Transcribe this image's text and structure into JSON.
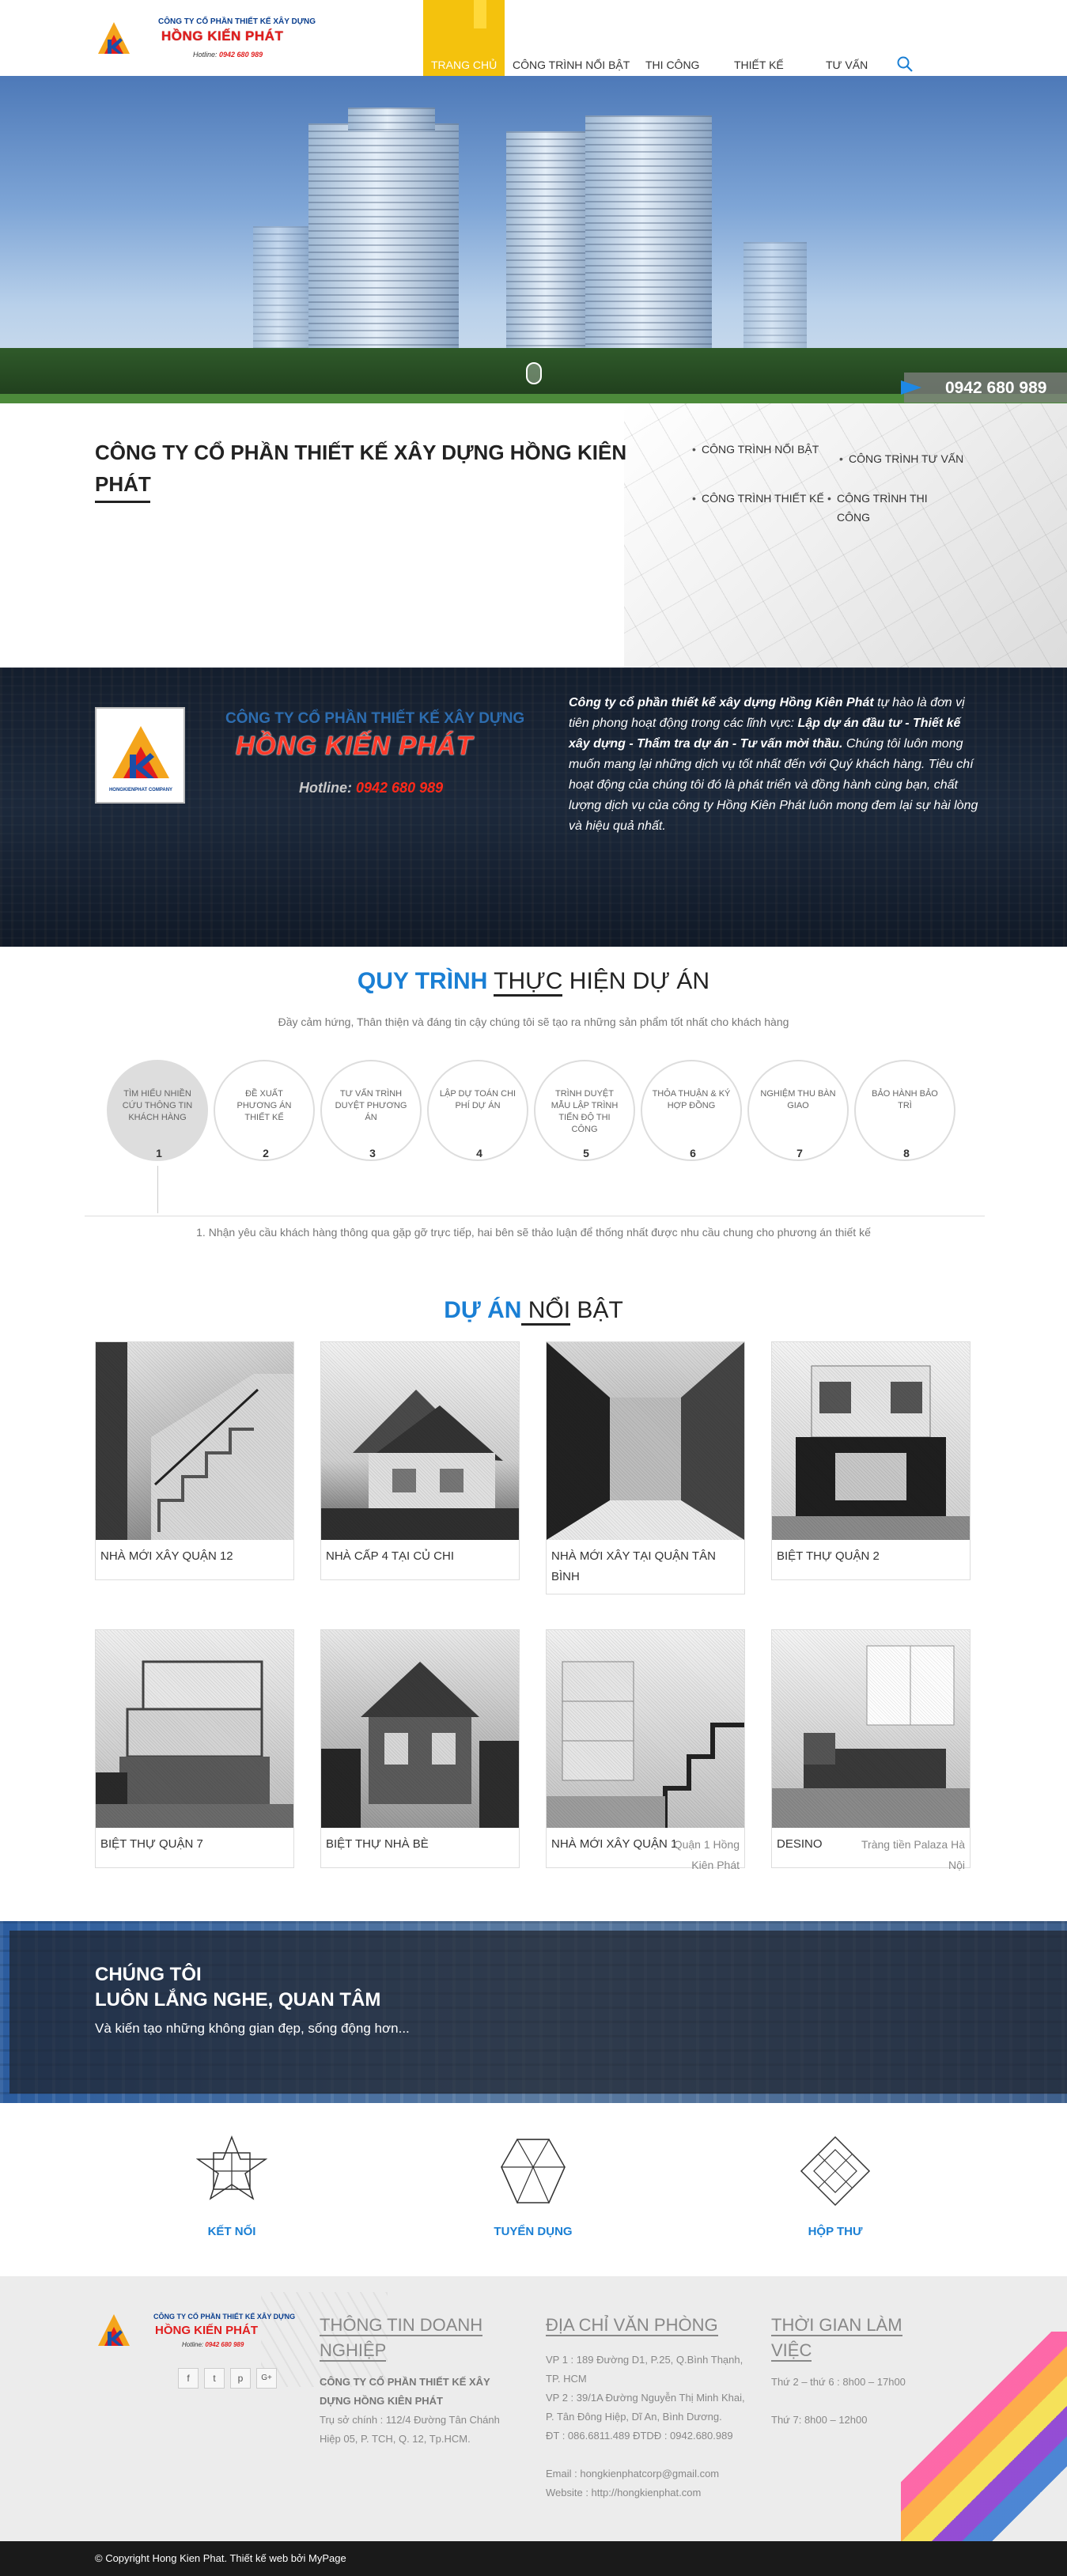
{
  "header": {
    "logo_company": "CÔNG TY CỔ PHẦN THIẾT KẾ XÂY DỰNG",
    "logo_brand": "HỒNG KIẾN PHÁT",
    "logo_hotline_label": "Hotline:",
    "logo_hotline": "0942 680 989",
    "nav": [
      "TRANG CHỦ",
      "CÔNG TRÌNH NỔI BẬT",
      "THI CÔNG",
      "THIẾT KẾ",
      "TƯ VẤN"
    ],
    "active_color": "#f4c20d"
  },
  "hero": {
    "phone": "0942 680 989"
  },
  "intro": {
    "title": "CÔNG TY CỔ PHẦN THIẾT KẾ XÂY DỰNG HỒNG KIÊN PHÁT",
    "services": [
      "CÔNG TRÌNH NỔI BẬT",
      "CÔNG TRÌNH TƯ VẤN",
      "CÔNG TRÌNH THIẾT KẾ",
      "CÔNG TRÌNH THI CÔNG"
    ]
  },
  "company": {
    "logo_sub": "HONGKIENPHAT COMPANY",
    "name": "CÔNG TY CỔ PHẦN THIẾT KẾ XÂY DỰNG",
    "brand": "HỒNG KIẾN PHÁT",
    "hotline_label": "Hotline:",
    "hotline": "0942 680 989",
    "desc_1": "Công ty cổ phần thiết kế xây dựng Hồng Kiên Phát",
    "desc_2": " tự hào là đơn vị tiên phong hoạt động trong các lĩnh vực: ",
    "desc_3": "Lập dự án đầu tư - Thiết kế xây dựng - Thẩm tra dự án - Tư vấn mời thầu.",
    "desc_4": " Chúng tôi luôn mong muốn mang lại những dịch vụ tốt nhất đến với Quý khách hàng. Tiêu chí hoạt động của chúng tôi đó là phát triển và đồng hành cùng bạn, chất lượng dịch vụ của công ty Hồng Kiên Phát luôn mong đem lại sự hài lòng và hiệu quả nhất."
  },
  "process": {
    "title_a": "QUY TRÌNH",
    "title_b": "THỰC",
    "title_c": " HIỆN DỰ ÁN",
    "subtitle": "Đầy cảm hứng, Thân thiện và đáng tin cậy chúng tôi sẽ tạo ra những sản phẩm tốt nhất cho khách hàng",
    "steps": [
      {
        "label": "TÌM HIỂU NHIỀN CỨU THÔNG TIN KHÁCH HÀNG",
        "num": "1"
      },
      {
        "label": "ĐỀ XUẤT PHƯƠNG ÁN THIẾT KẾ",
        "num": "2"
      },
      {
        "label": "TƯ VẤN TRÌNH DUYỆT PHƯƠNG ÁN",
        "num": "3"
      },
      {
        "label": "LẬP DỰ TOÁN CHI PHÍ DỰ ÁN",
        "num": "4"
      },
      {
        "label": "TRÌNH DUYỆT MẪU LẬP TRÌNH TIẾN ĐỘ THI CÔNG",
        "num": "5"
      },
      {
        "label": "THỎA THUẬN & KÝ HỢP ĐỒNG",
        "num": "6"
      },
      {
        "label": "NGHIỆM THU BÀN GIAO",
        "num": "7"
      },
      {
        "label": "BẢO HÀNH BẢO TRÌ",
        "num": "8"
      }
    ],
    "note": "1. Nhận yêu cầu khách hàng thông qua gặp gỡ trực tiếp, hai bên sẽ thảo luận để thống nhất được nhu cầu chung cho phương án thiết kế"
  },
  "projects": {
    "title_a": "DỰ ÁN",
    "title_b": " NỔI",
    "title_c": " BẬT",
    "items": [
      {
        "caption": "NHÀ MỚI XÂY QUẬN 12",
        "extra": ""
      },
      {
        "caption": "NHÀ CẤP 4 TẠI CỦ CHI",
        "extra": ""
      },
      {
        "caption": "NHÀ MỚI XÂY TẠI QUẬN TÂN BÌNH",
        "extra": ""
      },
      {
        "caption": "BIỆT THỰ QUẬN 2",
        "extra": ""
      },
      {
        "caption": "BIỆT THỰ QUẬN 7",
        "extra": ""
      },
      {
        "caption": "BIỆT THỰ NHÀ BÈ",
        "extra": ""
      },
      {
        "caption": "NHÀ MỚI XÂY QUẬN 1",
        "extra": "Quận 1 Hồng Kiên Phát"
      },
      {
        "caption": "DESINO",
        "extra": "Tràng tiền Palaza Hà Nội"
      }
    ]
  },
  "listen": {
    "line1": "CHÚNG TÔI",
    "line2": "LUÔN LẮNG NGHE, QUAN TÂM",
    "sub": "Và kiến tạo những không gian đẹp, sống động hơn..."
  },
  "connect": {
    "items": [
      "KẾT NỐI",
      "TUYỂN DỤNG",
      "HỘP THƯ"
    ]
  },
  "footer": {
    "logo_company": "CÔNG TY CỔ PHẦN THIẾT KẾ XÂY DỰNG",
    "logo_brand": "HỒNG KIẾN PHÁT",
    "logo_hotline_label": "Hotline:",
    "logo_hotline": "0942 680 989",
    "social": [
      "f",
      "t",
      "p",
      "G+"
    ],
    "col1_title": "THÔNG TIN DOANH NGHIỆP",
    "col1_name": "CÔNG TY CỔ PHẦN THIẾT KẾ XÂY DỰNG HỒNG KIÊN PHÁT",
    "col1_addr": "Trụ sở chính :  112/4 Đường Tân Chánh Hiệp 05, P. TCH, Q. 12, Tp.HCM.",
    "col2_title": "ĐỊA CHỈ VĂN PHÒNG",
    "col2_vp1": "VP 1 :  189 Đường D1, P.25, Q.Bình Thạnh, TP. HCM",
    "col2_vp2": "VP 2 :  39/1A Đường Nguyễn Thị Minh Khai, P. Tân Đông Hiệp, Dĩ An, Bình Dương.",
    "col2_phone": "ĐT : 086.6811.489     ĐTDĐ : 0942.680.989",
    "col2_email": "Email : hongkienphatcorp@gmail.com",
    "col2_web": "Website : http://hongkienphat.com",
    "col3_title": "THỜI GIAN LÀM VIỆC",
    "col3_line1": "Thứ 2 – thứ 6 : 8h00 – 17h00",
    "col3_line2": "Thứ 7: 8h00 – 12h00",
    "copyright": "© Copyright Hong Kien Phat. Thiết kế web bởi MyPage"
  }
}
